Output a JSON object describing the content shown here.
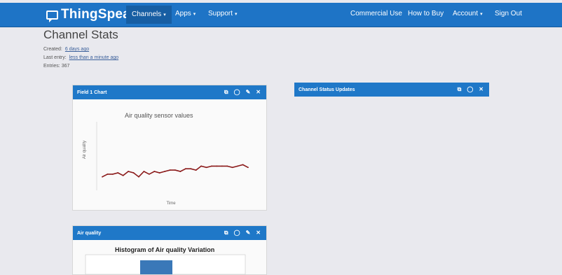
{
  "header": {
    "logo": "ThingSpeak",
    "logo_tm": "™",
    "nav": {
      "channels": "Channels",
      "apps": "Apps",
      "support": "Support",
      "commercial_use": "Commercial Use",
      "how_to_buy": "How to Buy",
      "account": "Account",
      "sign_out": "Sign Out"
    },
    "caret": "▾"
  },
  "page": {
    "title": "Channel Stats",
    "created_label": "Created:",
    "created_value": "6 days ago",
    "last_entry_label": "Last entry:",
    "last_entry_value": "less than a minute ago",
    "entries_label": "Entries:",
    "entries_value": "367"
  },
  "panels": {
    "field1": {
      "title": "Field 1 Chart",
      "chart_title": "Air quality sensor values",
      "y_label": "Air quality",
      "x_label": "Time"
    },
    "status": {
      "title": "Channel Status Updates"
    },
    "airquality": {
      "title": "Air quality",
      "hist_title": "Histogram of Air quality Variation"
    }
  },
  "icons": {
    "popout": "⧉",
    "comment": "◯",
    "edit": "✎",
    "close": "✕"
  },
  "chart_data": {
    "type": "line",
    "title": "Air quality sensor values",
    "xlabel": "Time",
    "ylabel": "Air quality",
    "series": [
      {
        "values": [
          0.09,
          0.11,
          0.11,
          0.12,
          0.1,
          0.13,
          0.12,
          0.09,
          0.13,
          0.11,
          0.13,
          0.12,
          0.13,
          0.14,
          0.14,
          0.13,
          0.15,
          0.15,
          0.14,
          0.17,
          0.16,
          0.17,
          0.17,
          0.17,
          0.17,
          0.16,
          0.17,
          0.18,
          0.16
        ]
      }
    ],
    "ylim": [
      0,
      0.5
    ],
    "color": "#8b1a1a"
  }
}
